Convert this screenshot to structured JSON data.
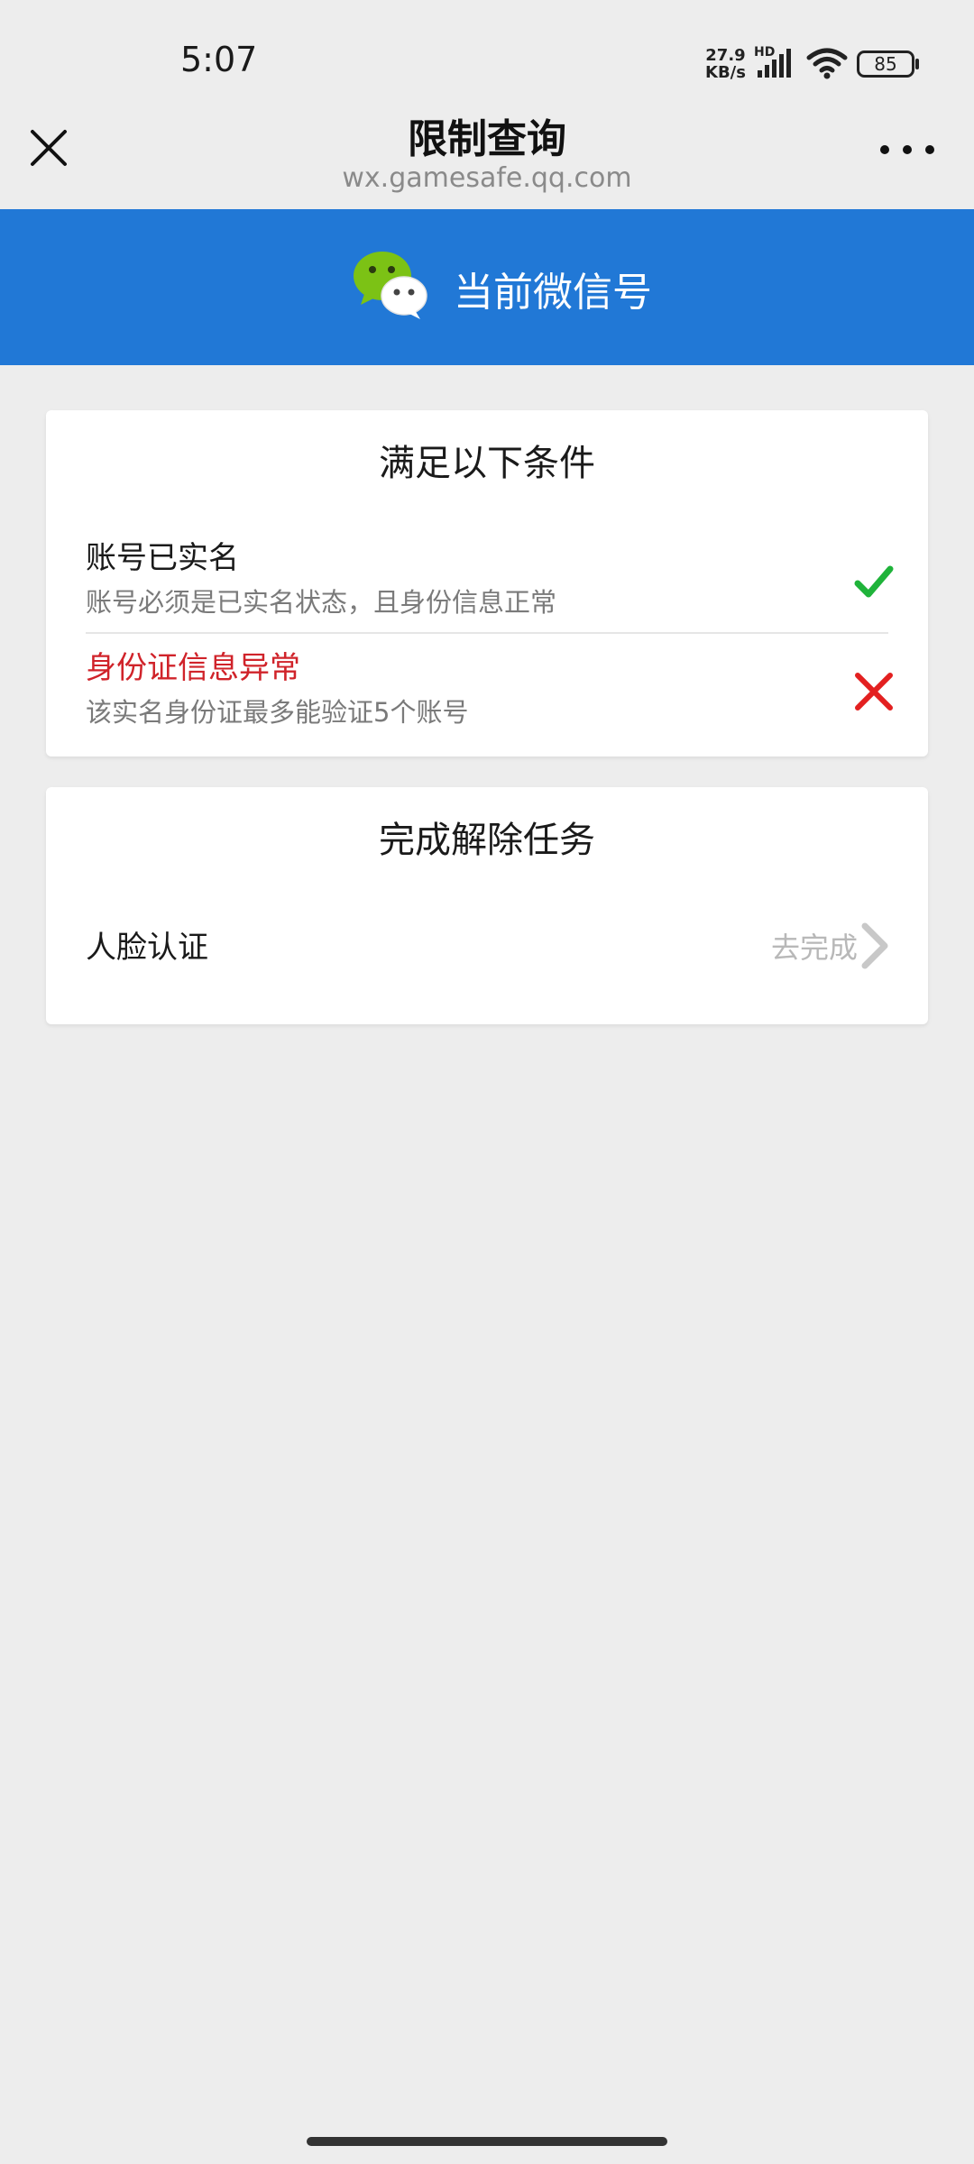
{
  "status_bar": {
    "time": "5:07",
    "net_speed_value": "27.9",
    "net_speed_unit": "KB/s",
    "hd_label": "HD",
    "battery": "85"
  },
  "nav": {
    "title": "限制查询",
    "url": "wx.gamesafe.qq.com"
  },
  "banner": {
    "text": "当前微信号"
  },
  "conditions": {
    "title": "满足以下条件",
    "items": [
      {
        "title": "账号已实名",
        "desc": "账号必须是已实名状态，且身份信息正常",
        "status": "pass"
      },
      {
        "title": "身份证信息异常",
        "desc": "该实名身份证最多能验证5个账号",
        "status": "fail"
      }
    ]
  },
  "tasks": {
    "title": "完成解除任务",
    "items": [
      {
        "label": "人脸认证",
        "action": "去完成"
      }
    ]
  },
  "colors": {
    "banner": "#2178d6",
    "error": "#d0232a",
    "success": "#1fb33a",
    "fail": "#e32020"
  }
}
